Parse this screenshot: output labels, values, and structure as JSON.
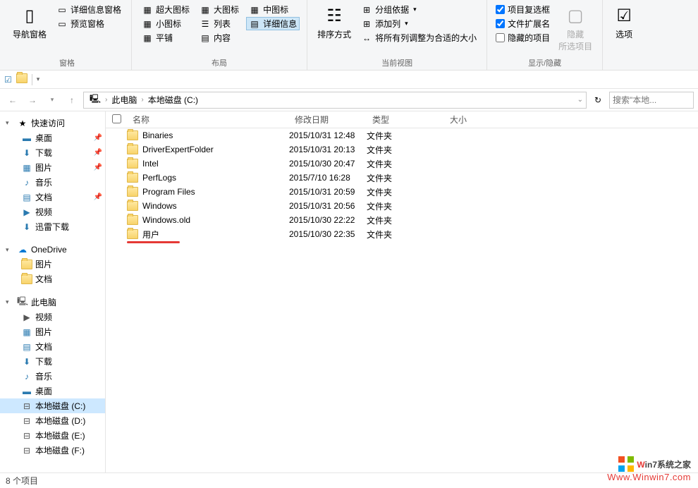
{
  "ribbon": {
    "panes": {
      "label": "窗格",
      "nav_pane": "导航窗格",
      "detail_pane": "详细信息窗格",
      "preview_pane": "预览窗格"
    },
    "layout": {
      "label": "布局",
      "xl_icon": "超大图标",
      "lg_icon": "大图标",
      "md_icon": "中图标",
      "sm_icon": "小图标",
      "list": "列表",
      "details": "详细信息",
      "tiles": "平铺",
      "content": "内容"
    },
    "current_view": {
      "label": "当前视图",
      "sort": "排序方式",
      "group_by": "分组依据",
      "add_columns": "添加列",
      "fit_columns": "将所有列调整为合适的大小"
    },
    "show_hide": {
      "label": "显示/隐藏",
      "checkboxes": "项目复选框",
      "extensions": "文件扩展名",
      "hidden_items": "隐藏的项目",
      "hide": "隐藏\n所选项目"
    },
    "options": {
      "label": "选项"
    }
  },
  "breadcrumb": {
    "pc": "此电脑",
    "drive": "本地磁盘 (C:)"
  },
  "search": {
    "placeholder": "搜索\"本地..."
  },
  "sidebar": {
    "quick_access": "快速访问",
    "desktop": "桌面",
    "downloads": "下载",
    "pictures": "图片",
    "music": "音乐",
    "documents": "文档",
    "videos": "视频",
    "xunlei": "迅雷下载",
    "onedrive": "OneDrive",
    "od_pictures": "图片",
    "od_documents": "文档",
    "this_pc": "此电脑",
    "pc_videos": "视频",
    "pc_pictures": "图片",
    "pc_documents": "文档",
    "pc_downloads": "下载",
    "pc_music": "音乐",
    "pc_desktop": "桌面",
    "drive_c": "本地磁盘 (C:)",
    "drive_d": "本地磁盘 (D:)",
    "drive_e": "本地磁盘 (E:)",
    "drive_f": "本地磁盘 (F:)"
  },
  "columns": {
    "name": "名称",
    "date": "修改日期",
    "type": "类型",
    "size": "大小"
  },
  "files": [
    {
      "name": "Binaries",
      "date": "2015/10/31 12:48",
      "type": "文件夹"
    },
    {
      "name": "DriverExpertFolder",
      "date": "2015/10/31 20:13",
      "type": "文件夹"
    },
    {
      "name": "Intel",
      "date": "2015/10/30 20:47",
      "type": "文件夹"
    },
    {
      "name": "PerfLogs",
      "date": "2015/7/10 16:28",
      "type": "文件夹"
    },
    {
      "name": "Program Files",
      "date": "2015/10/31 20:59",
      "type": "文件夹"
    },
    {
      "name": "Windows",
      "date": "2015/10/31 20:56",
      "type": "文件夹"
    },
    {
      "name": "Windows.old",
      "date": "2015/10/30 22:22",
      "type": "文件夹"
    },
    {
      "name": "用户",
      "date": "2015/10/30 22:35",
      "type": "文件夹"
    }
  ],
  "status": {
    "count": "8 个项目"
  },
  "watermark": {
    "brand_w": "W",
    "brand_rest": "in7系统之家",
    "url": "Www.Winwin7.com"
  }
}
